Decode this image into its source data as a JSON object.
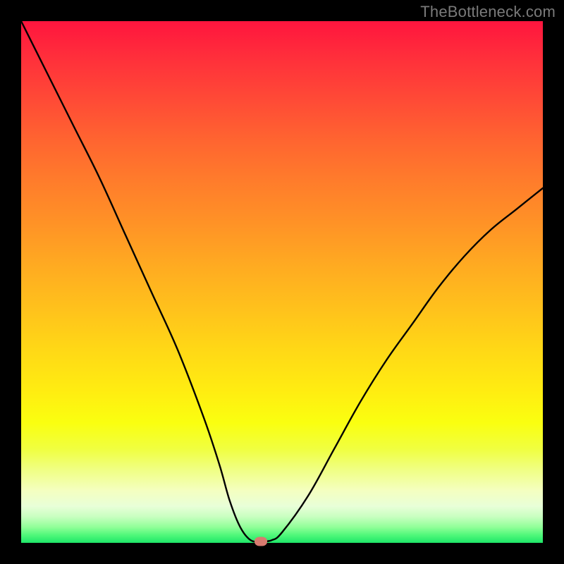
{
  "watermark": "TheBottleneck.com",
  "chart_data": {
    "type": "line",
    "title": "",
    "xlabel": "",
    "ylabel": "",
    "x_range": [
      0,
      100
    ],
    "y_range": [
      0,
      100
    ],
    "grid": false,
    "legend": false,
    "series": [
      {
        "name": "bottleneck-curve",
        "x": [
          0,
          5,
          10,
          15,
          20,
          25,
          30,
          35,
          38,
          40,
          42,
          44,
          46,
          48,
          50,
          55,
          60,
          65,
          70,
          75,
          80,
          85,
          90,
          95,
          100
        ],
        "y": [
          100,
          90,
          80,
          70,
          59,
          48,
          37,
          24,
          15,
          8,
          3,
          0.5,
          0.3,
          0.5,
          2,
          9,
          18,
          27,
          35,
          42,
          49,
          55,
          60,
          64,
          68
        ]
      }
    ],
    "marker": {
      "x": 46,
      "y": 0.3,
      "color": "#d87a6f"
    },
    "background_gradient": {
      "top": "#ff153e",
      "mid": "#ffd816",
      "bottom": "#1ee668"
    }
  }
}
